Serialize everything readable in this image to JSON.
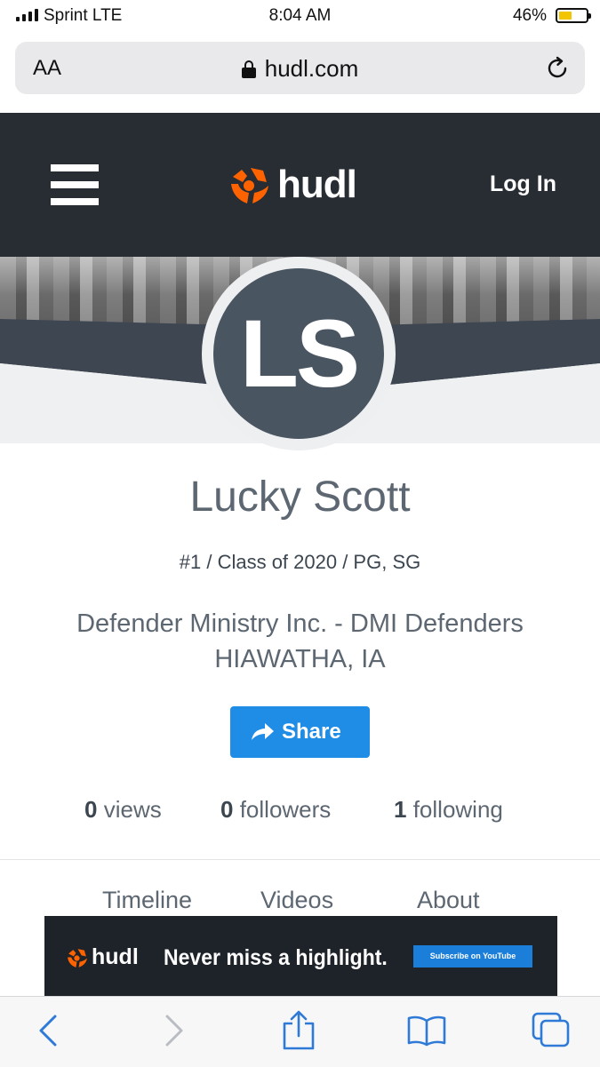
{
  "status_bar": {
    "carrier": "Sprint LTE",
    "time": "8:04 AM",
    "battery": "46%"
  },
  "browser": {
    "text_size": "AA",
    "url": "hudl.com"
  },
  "nav": {
    "brand": "hudl",
    "login": "Log In"
  },
  "profile": {
    "initials": "LS",
    "name": "Lucky Scott",
    "meta": "#1 / Class of 2020 / PG, SG",
    "team": "Defender Ministry Inc. - DMI Defenders",
    "location": "HIAWATHA, IA",
    "share": "Share",
    "stats": {
      "views_count": "0",
      "views_label": "views",
      "followers_count": "0",
      "followers_label": "followers",
      "following_count": "1",
      "following_label": "following"
    },
    "tabs": [
      "Timeline",
      "Videos",
      "About"
    ]
  },
  "ad": {
    "brand": "hudl",
    "tagline": "Never miss a highlight.",
    "cta": "Subscribe on YouTube"
  },
  "colors": {
    "nav_bg": "#282c33",
    "brand_orange": "#ff6300",
    "share_blue": "#1f8ce6",
    "avatar_bg": "#4a5562",
    "ios_blue": "#2f7ad6"
  },
  "icons": [
    "signal-icon",
    "battery-icon",
    "lock-icon",
    "reload-icon",
    "menu-icon",
    "hudl-logo-icon",
    "share-arrow-icon",
    "back-icon",
    "forward-icon",
    "share-sheet-icon",
    "bookmarks-icon",
    "tabs-icon"
  ]
}
